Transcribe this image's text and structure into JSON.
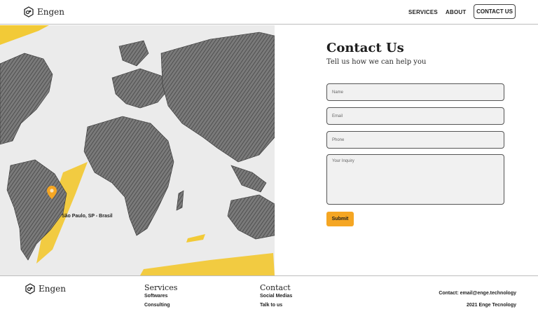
{
  "brand": {
    "name": "Engen",
    "logo_icon": "engen-logo-icon"
  },
  "nav": {
    "services": "SERVICES",
    "about": "ABOUT",
    "contact": "CONTACT US"
  },
  "map": {
    "location_label": "São Paulo, SP - Brasil",
    "pin_icon": "location-pin-icon",
    "accent": "#f5a623"
  },
  "contact": {
    "title": "Contact Us",
    "subtitle": "Tell us how we can help you",
    "name_placeholder": "Name",
    "email_placeholder": "Email",
    "phone_placeholder": "Phone",
    "inquiry_placeholder": "Your Inquiry",
    "submit_label": "Submit"
  },
  "footer": {
    "services_heading": "Services",
    "services_links": [
      "Softwares",
      "Consulting"
    ],
    "contact_heading": "Contact",
    "contact_links": [
      "Social Medias",
      "Talk to us"
    ],
    "contact_email": "Contact: email@enge.technology",
    "copyright": "2021 Enge Tecnology"
  },
  "colors": {
    "accent": "#f5a623",
    "border": "#555555",
    "field_bg": "#f1f1f1"
  }
}
